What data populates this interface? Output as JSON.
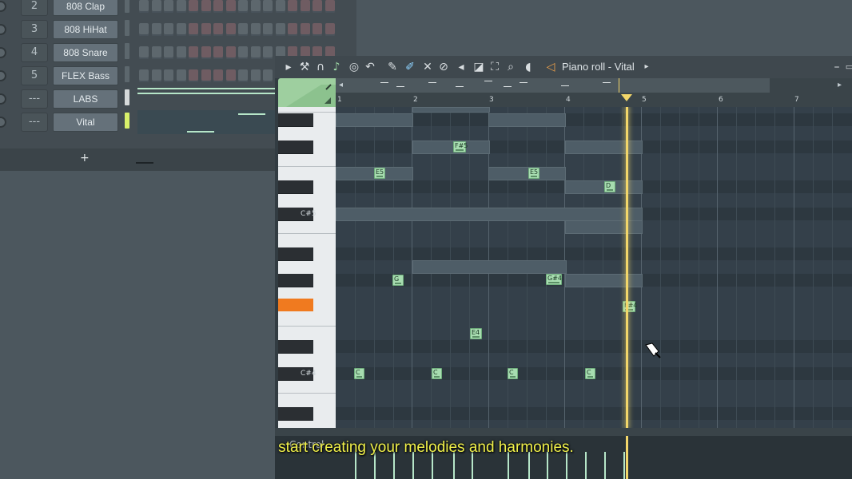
{
  "channel_rack": {
    "channels": [
      {
        "num": "2",
        "name": "808 Clap"
      },
      {
        "num": "3",
        "name": "808 HiHat"
      },
      {
        "num": "4",
        "name": "808 Snare"
      },
      {
        "num": "5",
        "name": "FLEX Bass"
      },
      {
        "num": "---",
        "name": "LABS"
      },
      {
        "num": "---",
        "name": "Vital"
      }
    ],
    "add_label": "+"
  },
  "piano_roll": {
    "title": "Piano roll - Vital",
    "ruler_numbers": [
      "1",
      "2",
      "3",
      "4",
      "5",
      "6",
      "7"
    ],
    "key_labels": {
      "cs5": "C#5",
      "cs4": "C#4"
    },
    "notes": [
      "F#5",
      "E5",
      "E5",
      "D",
      "G",
      "G#4",
      "F#4",
      "E4",
      "C",
      "C",
      "C",
      "C"
    ],
    "control_label": "Control"
  },
  "subtitle": "start creating your melodies and harmonies.",
  "colors": {
    "accent_green": "#a7dcb0",
    "playhead": "#f2d66a",
    "selected_key": "#f07a1f"
  }
}
